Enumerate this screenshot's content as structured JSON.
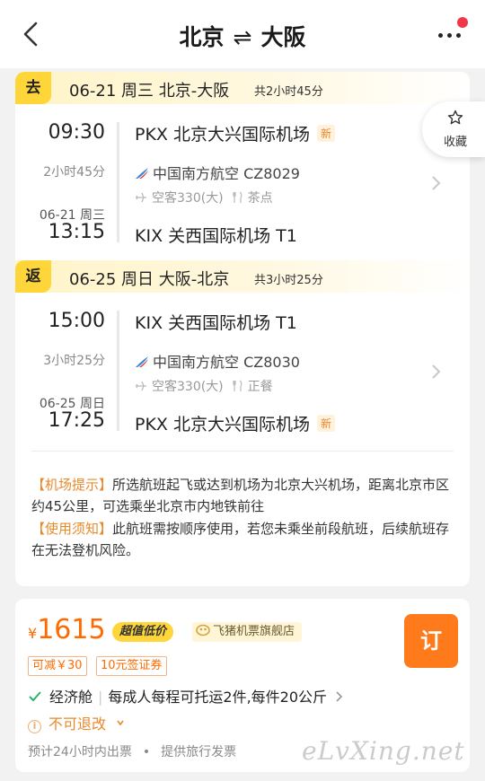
{
  "header": {
    "from": "北京",
    "swap": "⇌",
    "to": "大阪",
    "back_icon": "chevron-left-icon",
    "more_icon": "more-dots-icon"
  },
  "favorite": {
    "label": "收藏",
    "icon": "star-outline-icon"
  },
  "outbound": {
    "tag": "去",
    "summary": "06-21 周三 北京-大阪",
    "duration_total": "共2小时45分",
    "depart_time": "09:30",
    "depart_airport": "PKX 北京大兴国际机场",
    "depart_badge": "新",
    "flight_duration": "2小时45分",
    "airline": "中国南方航空 CZ8029",
    "aircraft": "空客330(大)",
    "meal": "茶点",
    "arrive_date": "06-21 周三",
    "arrive_time": "13:15",
    "arrive_airport": "KIX 关西国际机场 T1"
  },
  "return": {
    "tag": "返",
    "summary": "06-25 周日 大阪-北京",
    "duration_total": "共3小时25分",
    "depart_time": "15:00",
    "depart_airport": "KIX 关西国际机场 T1",
    "flight_duration": "3小时25分",
    "airline": "中国南方航空 CZ8030",
    "aircraft": "空客330(大)",
    "meal": "正餐",
    "arrive_date": "06-25 周日",
    "arrive_time": "17:25",
    "arrive_airport": "PKX 北京大兴国际机场",
    "arrive_badge": "新"
  },
  "notices": {
    "airport_label": "【机场提示】",
    "airport_text": "所选航班起飞或达到机场为北京大兴机场，距离北京市区约45公里，可选乘坐北京市内地铁前往",
    "usage_label": "【使用须知】",
    "usage_text": "此航班需按顺序使用，若您未乘坐前段航班，后续航班存在无法登机风险。"
  },
  "offer": {
    "currency": "¥",
    "price": "1615",
    "deal_badge": "超值低价",
    "store": "飞猪机票旗舰店",
    "coupons": [
      "可减￥30",
      "10元签证券"
    ],
    "book_label": "订",
    "cabin": "经济舱",
    "baggage": "每成人每程可托运2件,每件20公斤",
    "refund": "不可退改",
    "ticketing": "预计24小时内出票",
    "invoice": "提供旅行发票"
  },
  "watermark": "eLvXing.net",
  "colors": {
    "accent": "#ff6a00",
    "tag_yellow": "#ffd63a",
    "highlight": "#e8892a",
    "book_button": "#ff7a1a"
  }
}
